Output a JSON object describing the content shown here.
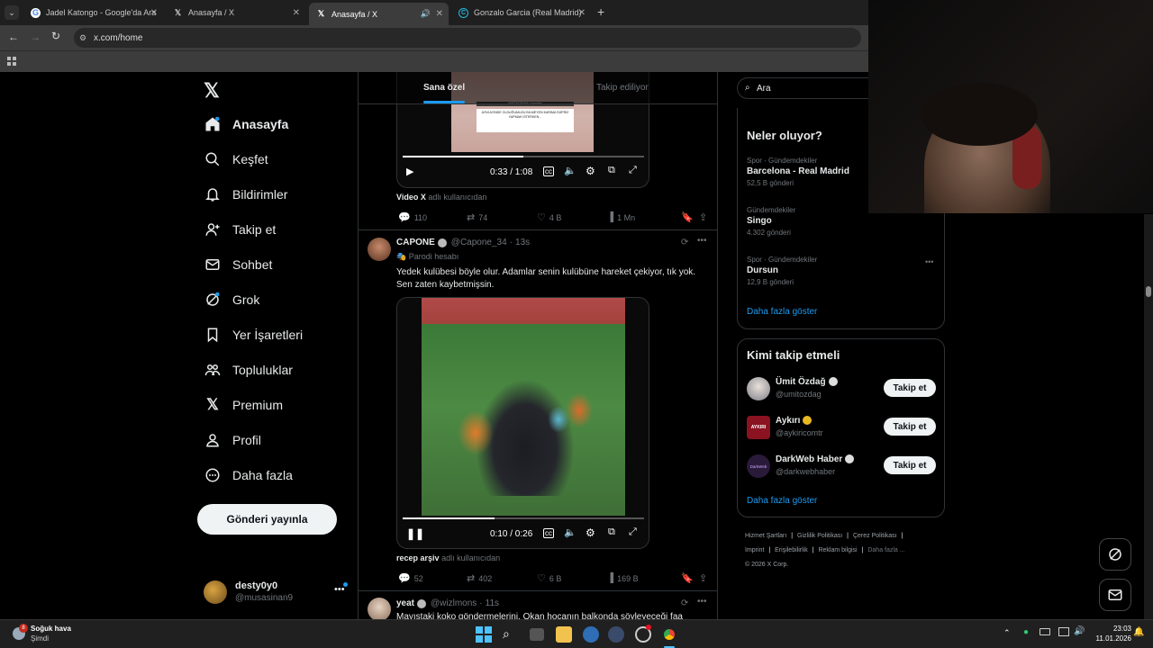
{
  "browser": {
    "tabs": [
      {
        "title": "Jadel Katongo - Google'da Ara",
        "icon": "google-icon"
      },
      {
        "title": "Anasayfa / X",
        "icon": "x-icon"
      },
      {
        "title": "Anasayfa / X",
        "icon": "x-icon"
      },
      {
        "title": "Gonzalo Garcia (Real Madrid) ile",
        "icon": "site-icon"
      }
    ],
    "url": "x.com/home"
  },
  "sidebar": {
    "items": [
      {
        "label": "Anasayfa",
        "icon": "home-icon"
      },
      {
        "label": "Keşfet",
        "icon": "search-icon"
      },
      {
        "label": "Bildirimler",
        "icon": "bell-icon"
      },
      {
        "label": "Takip et",
        "icon": "add-user-icon"
      },
      {
        "label": "Sohbet",
        "icon": "mail-icon"
      },
      {
        "label": "Grok",
        "icon": "grok-icon"
      },
      {
        "label": "Yer İşaretleri",
        "icon": "bookmark-icon"
      },
      {
        "label": "Topluluklar",
        "icon": "communities-icon"
      },
      {
        "label": "Premium",
        "icon": "x-icon"
      },
      {
        "label": "Profil",
        "icon": "person-icon"
      },
      {
        "label": "Daha fazla",
        "icon": "more-circle-icon"
      }
    ],
    "post_button": "Gönderi yayınla",
    "account": {
      "name": "desty0y0",
      "handle": "@musasinan9"
    }
  },
  "feed": {
    "tabs": [
      "Sana özel",
      "Takip ediliyor"
    ],
    "post1": {
      "overlay_title": "INSTAGRAM: kaanfirx",
      "overlay_text": "AYNI AYINDE OLDUĞUMUZU BİLMEYEN KARIMA SÜPRİZ YAPMAK İSTERKEN ..",
      "time": "0:33 / 1:08",
      "source_name": "Video X",
      "source_suffix": "adlı kullanıcıdan",
      "replies": "110",
      "reposts": "74",
      "likes": "4 B",
      "views": "1 Mn",
      "progress": 0.5
    },
    "post2": {
      "name": "CAPONE",
      "handle": "@Capone_34",
      "time": "13s",
      "parody": "Parodi hesabı",
      "text_line1": "Yedek kulübesi böyle olur. Adamlar senin kulübüne hareket çekiyor, tık yok.",
      "text_line2": "Sen zaten kaybetmişsin.",
      "video_time": "0:10 / 0:26",
      "source_name": "recep arşiv",
      "source_suffix": "adlı kullanıcıdan",
      "replies": "52",
      "reposts": "402",
      "likes": "6 B",
      "views": "169 B",
      "progress": 0.38
    },
    "post3": {
      "name": "yeat",
      "handle": "@wizlmons",
      "time": "11s",
      "text": "Mayıstaki koko göndermelerini, Okan hocanın balkonda söyleyeceği faa"
    }
  },
  "right": {
    "search_placeholder": "Ara",
    "trends_title": "Neler oluyor?",
    "trends": [
      {
        "category": "Spor · Gündemdekiler",
        "name": "Barcelona - Real Madrid",
        "count": "52,5 B gönderi"
      },
      {
        "category": "Gündemdekiler",
        "name": "Singo",
        "count": "4.302 gönderi"
      },
      {
        "category": "Spor · Gündemdekiler",
        "name": "Dursun",
        "count": "12,9 B gönderi"
      }
    ],
    "show_more": "Daha fazla göster",
    "follow_title": "Kimi takip etmeli",
    "follow": [
      {
        "name": "Ümit Özdağ",
        "handle": "@umitozdag",
        "button": "Takip et",
        "avatar_text": "",
        "verified_color": "#1d9bf0"
      },
      {
        "name": "Aykırı",
        "handle": "@aykiricomtr",
        "button": "Takip et",
        "avatar_text": "AYKIRI",
        "verified_color": "#e8b923"
      },
      {
        "name": "DarkWeb Haber",
        "handle": "@darkwebhaber",
        "button": "Takip et",
        "avatar_text": "DarkWeb",
        "verified_color": "#1d9bf0"
      }
    ],
    "footer_links": [
      "Hizmet Şartları",
      "Gizlilik Politikası",
      "Çerez Politikası",
      "Imprint",
      "Erişilebilirlik",
      "Reklam bilgisi",
      "Daha fazla ..."
    ],
    "copyright": "© 2026 X Corp."
  },
  "taskbar": {
    "weather_title": "Soğuk hava",
    "weather_sub": "Şimdi",
    "weather_badge": "8",
    "time": "23:03",
    "date": "11.01.2026"
  },
  "colors": {
    "accent": "#1d9bf0",
    "background": "#000000",
    "border": "#2f3336"
  }
}
